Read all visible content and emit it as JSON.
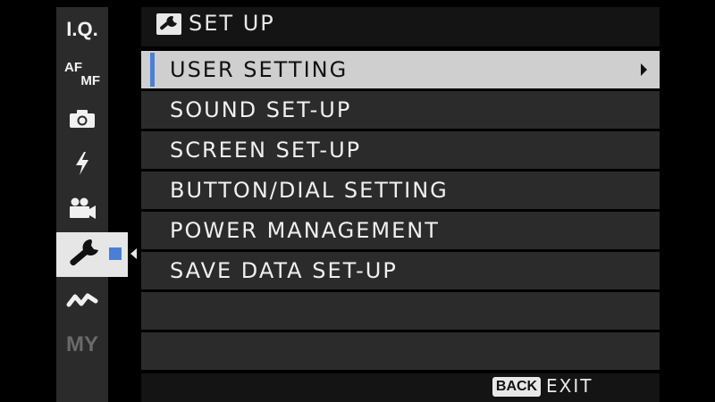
{
  "header": {
    "title": "SET UP",
    "icon": "wrench-icon"
  },
  "tabs": [
    {
      "label": "I.Q.",
      "icon": "iq-icon"
    },
    {
      "label": "AF MF",
      "icon": "af-mf-icon"
    },
    {
      "label": "",
      "icon": "camera-icon"
    },
    {
      "label": "",
      "icon": "flash-icon"
    },
    {
      "label": "",
      "icon": "movie-camera-icon"
    },
    {
      "label": "",
      "icon": "wrench-icon",
      "selected": true
    },
    {
      "label": "",
      "icon": "connection-icon"
    },
    {
      "label": "MY",
      "icon": "my-menu-icon",
      "dim": true
    }
  ],
  "menu": {
    "items": [
      {
        "label": "USER SETTING",
        "selected": true
      },
      {
        "label": "SOUND SET-UP"
      },
      {
        "label": "SCREEN SET-UP"
      },
      {
        "label": "BUTTON/DIAL SETTING"
      },
      {
        "label": "POWER MANAGEMENT"
      },
      {
        "label": "SAVE DATA SET-UP"
      },
      {
        "label": ""
      },
      {
        "label": ""
      }
    ]
  },
  "footer": {
    "back_label": "BACK",
    "exit_label": "EXIT"
  },
  "colors": {
    "accent": "#4a7fd8",
    "row_bg": "#2b2b2b",
    "selected_bg": "#cfcfcf"
  }
}
